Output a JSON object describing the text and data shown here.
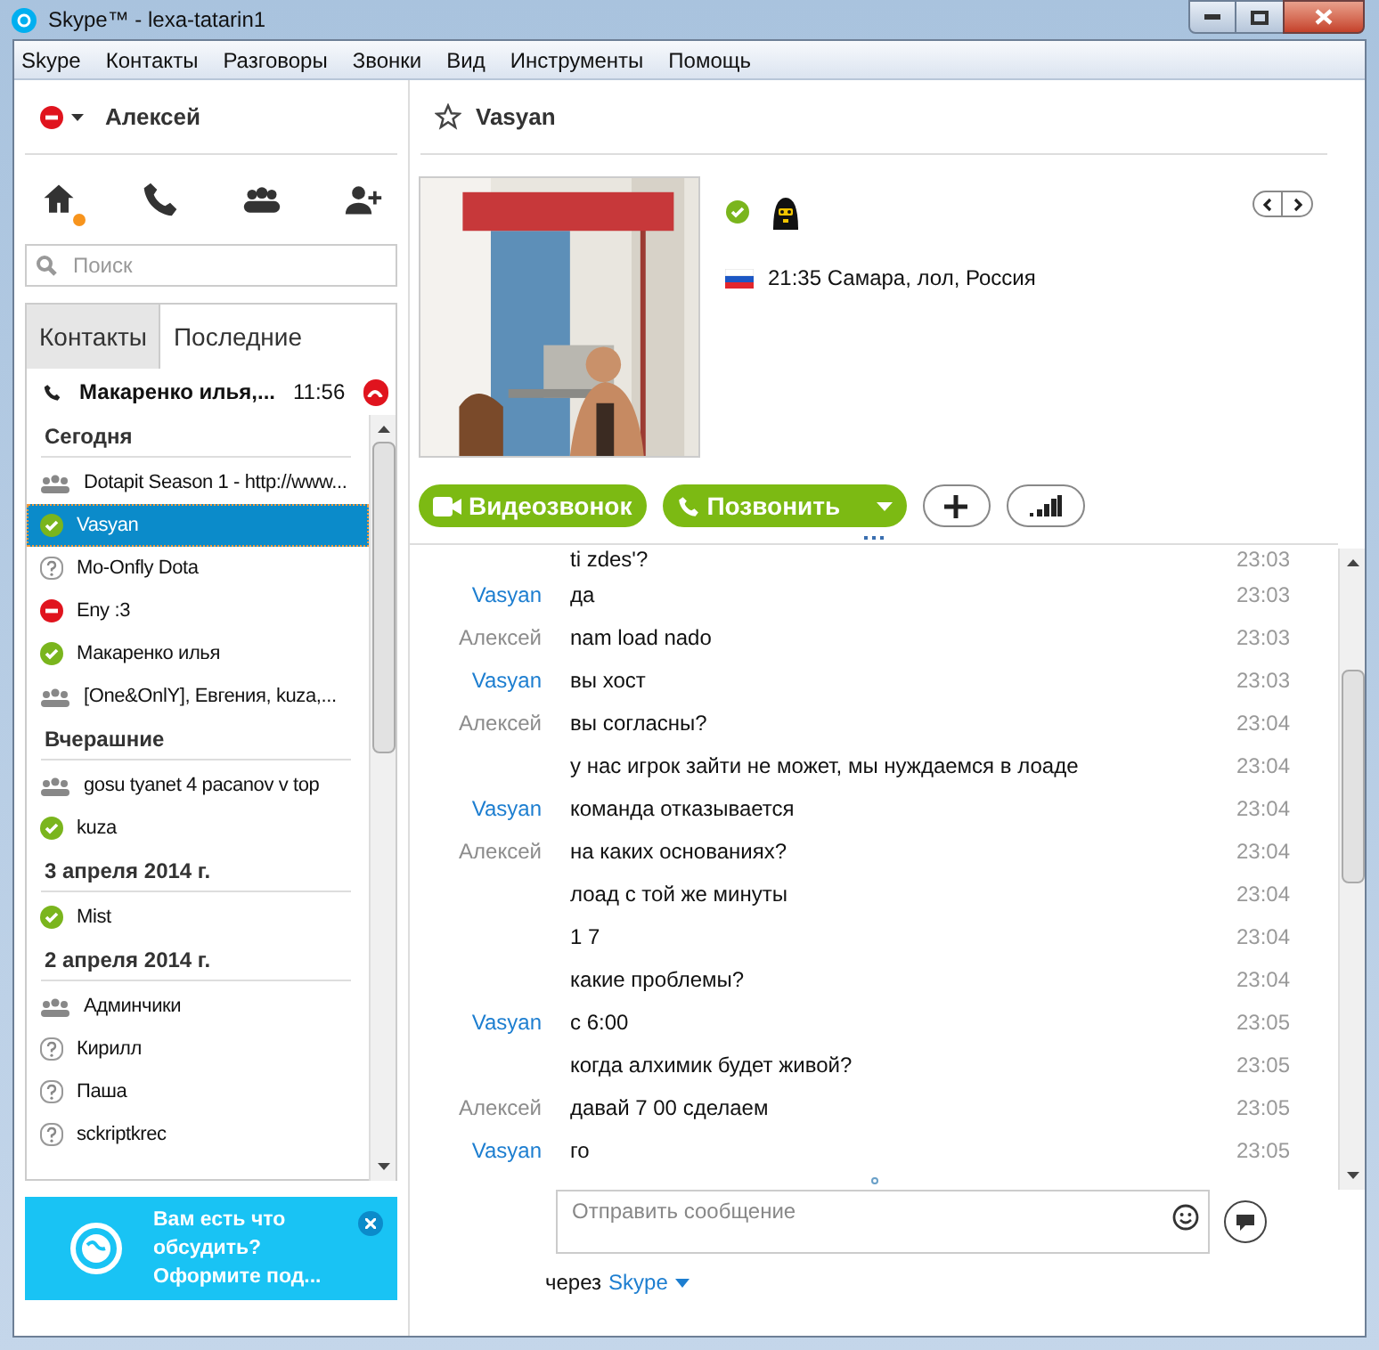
{
  "window": {
    "title": "Skype™ - lexa-tatarin1"
  },
  "menu": [
    "Skype",
    "Контакты",
    "Разговоры",
    "Звонки",
    "Вид",
    "Инструменты",
    "Помощь"
  ],
  "profile": {
    "name": "Алексей",
    "kind": "dnd"
  },
  "nav_icons": [
    {
      "kind": "home",
      "notify": true
    },
    {
      "kind": "phone",
      "notify": false
    },
    {
      "kind": "group",
      "notify": false
    },
    {
      "kind": "add-contact",
      "notify": false
    }
  ],
  "search": {
    "placeholder": "Поиск"
  },
  "tabs": [
    {
      "label": "Контакты",
      "selected": true
    },
    {
      "label": "Последние",
      "selected": false
    }
  ],
  "active_call": {
    "name": "Макаренко илья,...",
    "time": "11:56"
  },
  "contact_groups": [
    {
      "heading": "Сегодня",
      "items": [
        {
          "name": "Dotapit Season 1 - http://www...",
          "kind": "group",
          "selected": false
        },
        {
          "name": "Vasyan",
          "kind": "online",
          "selected": true
        },
        {
          "name": "Mo-Onfly Dota",
          "kind": "unknown",
          "selected": false
        },
        {
          "name": "Eny :3",
          "kind": "dnd",
          "selected": false
        },
        {
          "name": "Макаренко илья",
          "kind": "online",
          "selected": false
        },
        {
          "name": "[One&OnlY], Евгения, kuza,...",
          "kind": "group",
          "selected": false
        }
      ]
    },
    {
      "heading": "Вчерашние",
      "items": [
        {
          "name": "gosu tyanet 4 pacanov v top",
          "kind": "group",
          "selected": false
        },
        {
          "name": "kuza",
          "kind": "online",
          "selected": false
        }
      ]
    },
    {
      "heading": "3 апреля 2014 г.",
      "items": [
        {
          "name": "Mist",
          "kind": "online",
          "selected": false
        }
      ]
    },
    {
      "heading": "2 апреля 2014 г.",
      "items": [
        {
          "name": "Админчики",
          "kind": "group",
          "selected": false
        },
        {
          "name": "Кирилл",
          "kind": "unknown",
          "selected": false
        },
        {
          "name": "Паша",
          "kind": "unknown",
          "selected": false
        },
        {
          "name": "sckriptkrec",
          "kind": "unknown",
          "selected": false
        }
      ]
    }
  ],
  "promo": {
    "text": "Вам есть что обсудить? Оформите под..."
  },
  "conversation": {
    "name": "Vasyan",
    "kind": "online",
    "local_time": "21:35 Самара, лол, Россия"
  },
  "actions": [
    {
      "kind": "video",
      "label": "Видеозвонок"
    },
    {
      "kind": "call",
      "label": "Позвонить"
    },
    {
      "kind": "add"
    },
    {
      "kind": "signal"
    }
  ],
  "messages": [
    {
      "text": "ti zdes'?",
      "time": "23:03"
    },
    {
      "sender": "Vasyan",
      "outgoing": false,
      "text": "да",
      "time": "23:03"
    },
    {
      "sender": "Алексей",
      "outgoing": true,
      "text": "nam load nado",
      "time": "23:03"
    },
    {
      "sender": "Vasyan",
      "outgoing": false,
      "text": "вы хост",
      "time": "23:03"
    },
    {
      "sender": "Алексей",
      "outgoing": true,
      "text": "вы согласны?",
      "time": "23:04"
    },
    {
      "text": "у нас игрок зайти не может, мы нуждаемся в лоаде",
      "time": "23:04"
    },
    {
      "sender": "Vasyan",
      "outgoing": false,
      "text": "команда отказывается",
      "time": "23:04"
    },
    {
      "sender": "Алексей",
      "outgoing": true,
      "text": "на каких основаниях?",
      "time": "23:04"
    },
    {
      "text": "лоад с той же минуты",
      "time": "23:04"
    },
    {
      "text": "1 7",
      "time": "23:04"
    },
    {
      "text": "какие проблемы?",
      "time": "23:04"
    },
    {
      "sender": "Vasyan",
      "outgoing": false,
      "text": "с 6:00",
      "time": "23:05"
    },
    {
      "text": "когда алхимик будет живой?",
      "time": "23:05"
    },
    {
      "sender": "Алексей",
      "outgoing": true,
      "text": "давай 7 00  сделаем",
      "time": "23:05"
    },
    {
      "sender": "Vasyan",
      "outgoing": false,
      "text": "го",
      "time": "23:05"
    }
  ],
  "composer": {
    "placeholder": "Отправить сообщение"
  },
  "via": {
    "prefix": "через",
    "service": "Skype"
  }
}
